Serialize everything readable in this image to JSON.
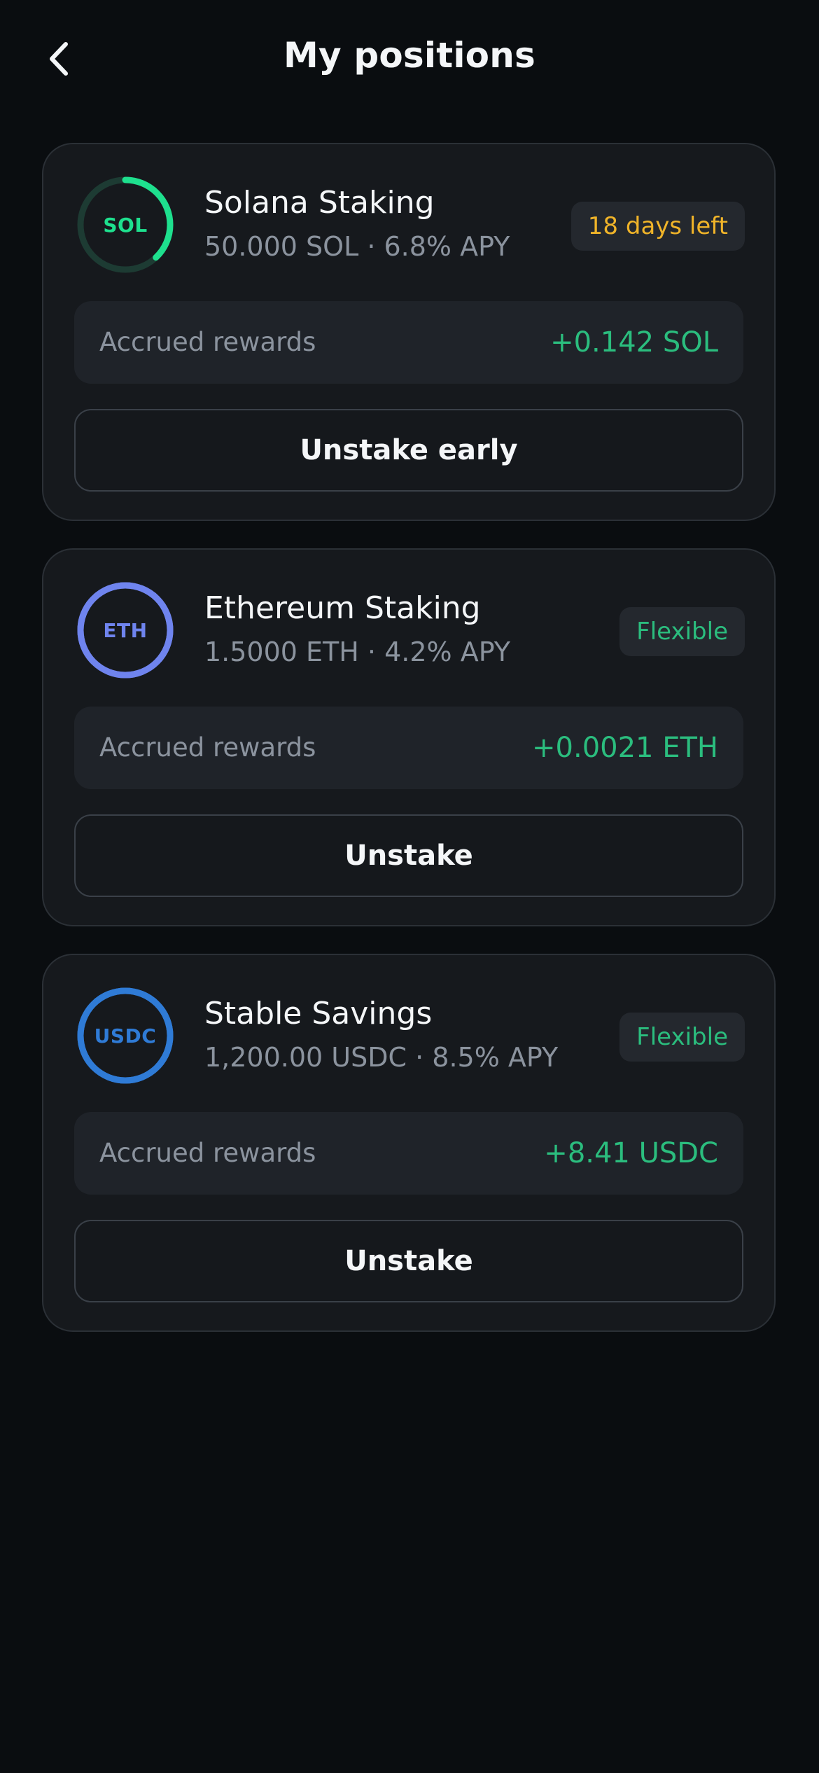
{
  "header": {
    "title": "My positions",
    "back_icon": "chevron-left-icon"
  },
  "colors": {
    "background": "#0a0d10",
    "card": "#16191d",
    "reward_green": "#2bbd7e",
    "badge_amber": "#f0b429",
    "badge_green": "#2bbd7e"
  },
  "positions": [
    {
      "token": "SOL",
      "name": "Solana Staking",
      "subtitle": "50.000 SOL · 6.8% APY",
      "badge": "18 days left",
      "badge_color": "#f0b429",
      "ring_color": "#1ee08e",
      "ring_track_color": "#1d3b33",
      "ring_label_color": "#1ee08e",
      "progress": 0.38,
      "rewards_label": "Accrued rewards",
      "rewards_value": "+0.142 SOL",
      "action_label": "Unstake early"
    },
    {
      "token": "ETH",
      "name": "Ethereum Staking",
      "subtitle": "1.5000 ETH · 4.2% APY",
      "badge": "Flexible",
      "badge_color": "#2bbd7e",
      "ring_color": "#6f84ee",
      "ring_track_color": "#6f84ee",
      "ring_label_color": "#6f84ee",
      "progress": 1,
      "rewards_label": "Accrued rewards",
      "rewards_value": "+0.0021 ETH",
      "action_label": "Unstake"
    },
    {
      "token": "USDC",
      "name": "Stable Savings",
      "subtitle": "1,200.00 USDC · 8.5% APY",
      "badge": "Flexible",
      "badge_color": "#2bbd7e",
      "ring_color": "#2f7bd6",
      "ring_track_color": "#2f7bd6",
      "ring_label_color": "#2f7bd6",
      "progress": 1,
      "rewards_label": "Accrued rewards",
      "rewards_value": "+8.41 USDC",
      "action_label": "Unstake"
    }
  ]
}
